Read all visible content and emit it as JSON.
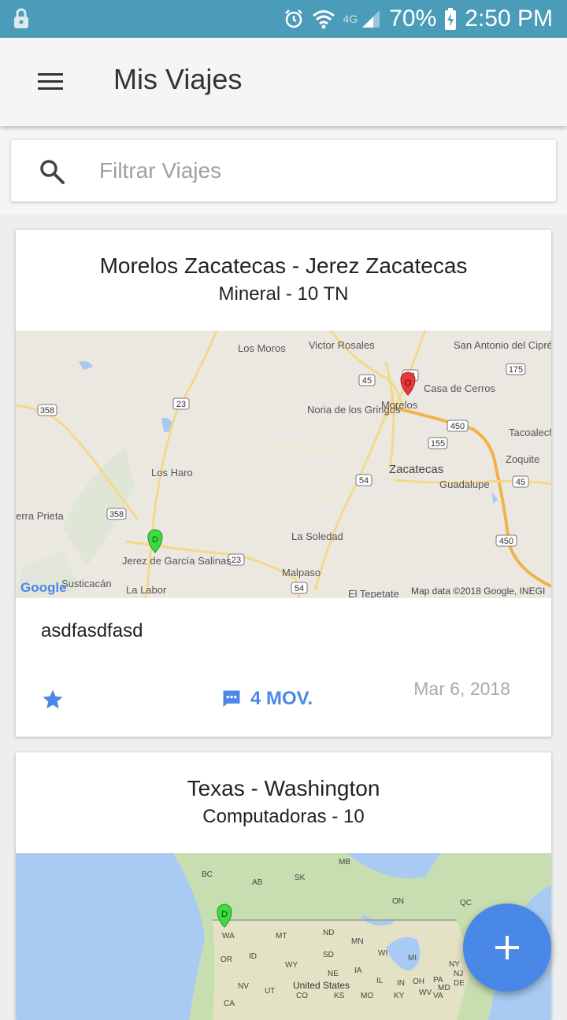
{
  "status_bar": {
    "network": "4G",
    "battery": "70%",
    "time": "2:50 PM"
  },
  "app_bar": {
    "title": "Mis Viajes"
  },
  "search": {
    "placeholder": "Filtrar Viajes",
    "value": ""
  },
  "trips": [
    {
      "route": "Morelos Zacatecas - Jerez Zacatecas",
      "cargo": "Mineral - 10 TN",
      "note": "asdfasdfasd",
      "movements": "4 MOV.",
      "date": "Mar 6, 2018",
      "map": {
        "labels": [
          "Los Moros",
          "Victor Rosales",
          "San Antonio del Ciprés",
          "Casa de Cerros",
          "Morelos",
          "Noria de los Gringos",
          "Tacoalech",
          "Zacatecas",
          "Zoquite",
          "Guadalupe",
          "Los Haro",
          "erra Prieta",
          "Jerez de García Salinas",
          "La Soledad",
          "Malpaso",
          "Susticacán",
          "La Labor",
          "El Tepetate"
        ],
        "shields": [
          "358",
          "23",
          "45",
          "54",
          "175",
          "450",
          "155",
          "54",
          "45",
          "358",
          "23",
          "450",
          "54"
        ],
        "attribution": "Map data ©2018 Google, INEGI",
        "logo": "Google"
      }
    },
    {
      "route": "Texas - Washington",
      "cargo": "Computadoras - 10",
      "map": {
        "labels": [
          "BC",
          "AB",
          "MB",
          "SK",
          "ON",
          "QC",
          "WA",
          "MT",
          "ND",
          "MN",
          "WI",
          "MI",
          "NY",
          "OR",
          "ID",
          "SD",
          "WY",
          "NE",
          "IA",
          "IL",
          "IN",
          "OH",
          "PA",
          "NV",
          "UT",
          "United States",
          "CO",
          "KS",
          "MO",
          "KY",
          "WV",
          "VA",
          "MD",
          "DE",
          "NJ",
          "CA"
        ]
      }
    }
  ],
  "colors": {
    "accent": "#4a88e8",
    "status_bar": "#4a9cb8",
    "pin_origin": "#e53935",
    "pin_destination": "#3ddc3d"
  }
}
